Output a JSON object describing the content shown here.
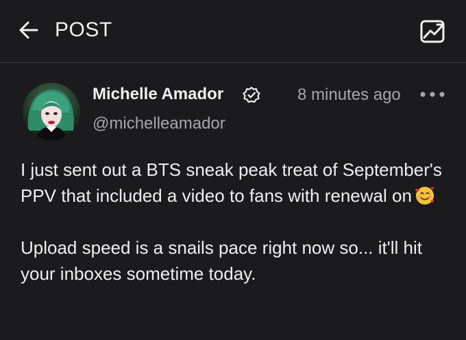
{
  "header": {
    "title": "POST",
    "back_icon": "arrow-left-icon",
    "stats_icon": "statistics-icon"
  },
  "post": {
    "author": {
      "name": "Michelle Amador",
      "handle": "@michelleamador",
      "verified": true,
      "verified_icon": "verified-badge-icon"
    },
    "time": "8 minutes ago",
    "more_icon": "more-dots-icon",
    "paragraph1": "I just sent out a BTS sneak peak treat of September's PPV that included a video to fans with renewal on",
    "emoji": "smiling-face-with-hearts",
    "paragraph2": "Upload speed is a snails pace right now so... it'll hit your inboxes sometime today."
  },
  "colors": {
    "background": "#1b1b1d",
    "text": "#efefef",
    "muted": "#a6a6ab",
    "divider": "#3a3a3d"
  }
}
